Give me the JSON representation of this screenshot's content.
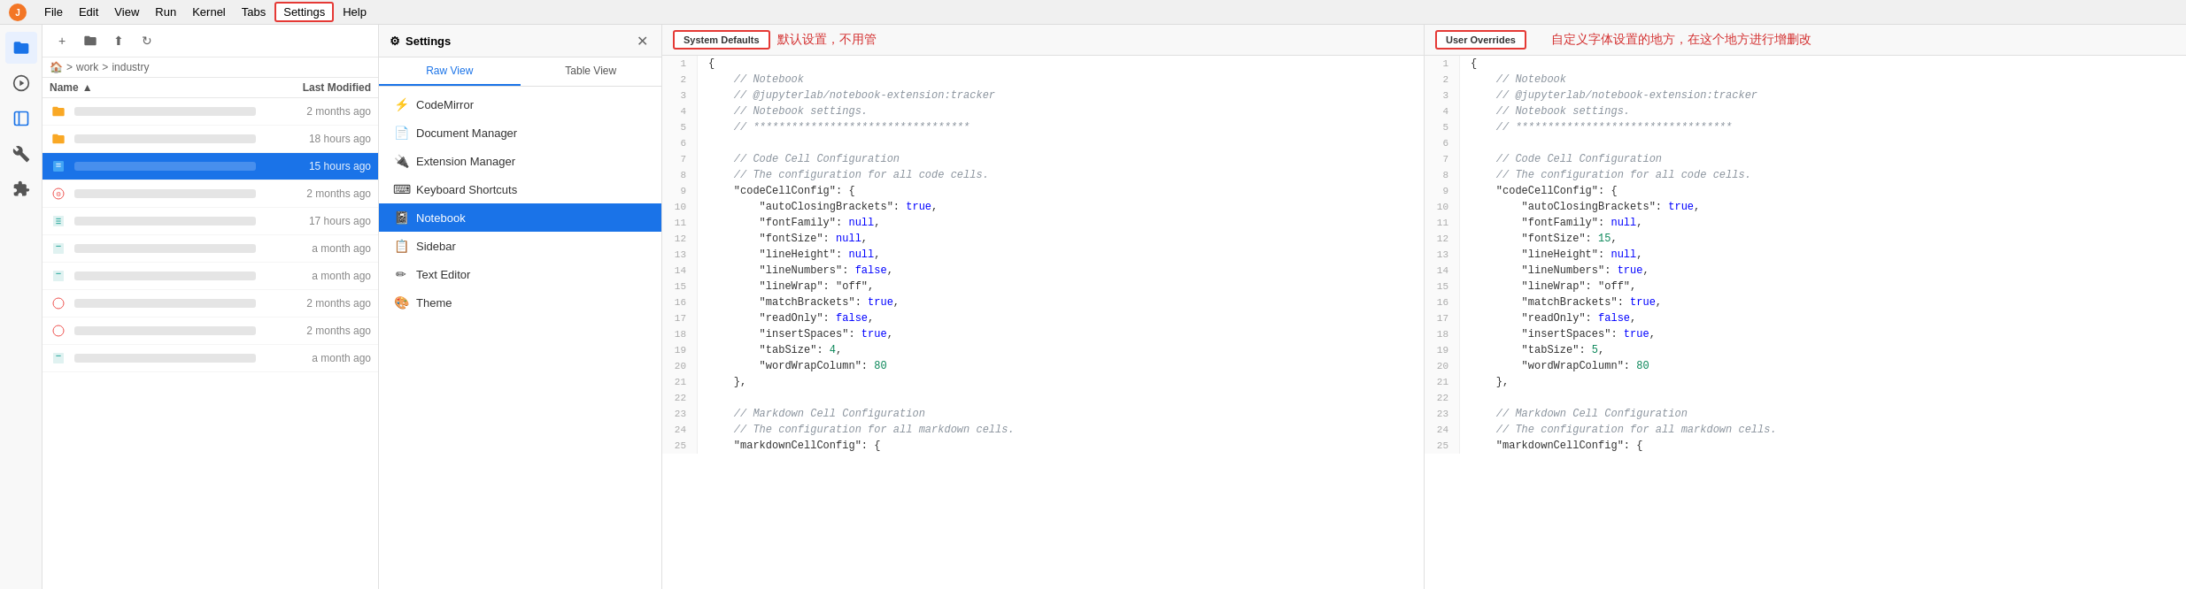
{
  "app": {
    "title": "JupyterLab"
  },
  "menubar": {
    "items": [
      "File",
      "Edit",
      "View",
      "Run",
      "Kernel",
      "Tabs",
      "Settings",
      "Help"
    ],
    "active": "Settings"
  },
  "toolbar": {
    "buttons": [
      "+",
      "📁",
      "⬆",
      "🔄"
    ]
  },
  "breadcrumb": {
    "items": [
      "🏠",
      "work",
      "industry"
    ],
    "separators": [
      ">",
      ">"
    ]
  },
  "filelist": {
    "header": {
      "name": "Name",
      "modified": "Last Modified"
    },
    "items": [
      {
        "icon": "📁",
        "name_blur": true,
        "modified": "2 months ago",
        "selected": false,
        "type": "folder"
      },
      {
        "icon": "📁",
        "name_blur": true,
        "modified": "18 hours ago",
        "selected": false,
        "type": "folder"
      },
      {
        "icon": "📄",
        "name_blur": true,
        "modified": "15 hours ago",
        "selected": true,
        "type": "notebook"
      },
      {
        "icon": "🔧",
        "name_blur": true,
        "modified": "2 months ago",
        "selected": false,
        "type": "tool"
      },
      {
        "icon": "📊",
        "name_blur": true,
        "modified": "17 hours ago",
        "selected": false,
        "type": "data"
      },
      {
        "icon": "📊",
        "name_blur": true,
        "modified": "a month ago",
        "selected": false,
        "type": "data"
      },
      {
        "icon": "📊",
        "name_blur": true,
        "modified": "a month ago",
        "selected": false,
        "type": "data"
      },
      {
        "icon": "🔧",
        "name_blur": true,
        "modified": "2 months ago",
        "selected": false,
        "type": "tool"
      },
      {
        "icon": "🔧",
        "name_blur": true,
        "modified": "2 months ago",
        "selected": false,
        "type": "tool"
      },
      {
        "icon": "📊",
        "name_blur": true,
        "modified": "a month ago",
        "selected": false,
        "type": "data"
      }
    ]
  },
  "settings": {
    "title": "Settings",
    "tabs": [
      "Raw View",
      "Table View"
    ],
    "active_tab": "Raw View",
    "menu_items": [
      {
        "icon": "⚡",
        "label": "CodeMirror"
      },
      {
        "icon": "📄",
        "label": "Document Manager"
      },
      {
        "icon": "🔌",
        "label": "Extension Manager"
      },
      {
        "icon": "⌨",
        "label": "Keyboard Shortcuts"
      },
      {
        "icon": "📓",
        "label": "Notebook",
        "active": true
      },
      {
        "icon": "📋",
        "label": "Sidebar"
      },
      {
        "icon": "✏",
        "label": "Text Editor"
      },
      {
        "icon": "🎨",
        "label": "Theme"
      }
    ]
  },
  "editor": {
    "panes": [
      {
        "label": "System Defaults",
        "label_note": "默认设置，不用管"
      },
      {
        "label": "User Overrides",
        "label_note": "自定义字体设置的地方，在这个地方进行增删改"
      }
    ],
    "code_lines": [
      "{",
      "    // Notebook",
      "    // @jupyterlab/notebook-extension:tracker",
      "    // Notebook settings.",
      "    // **********************************",
      "",
      "    // Code Cell Configuration",
      "    // The configuration for all code cells.",
      "    \"codeCellConfig\": {",
      "        \"autoClosingBrackets\": true,",
      "        \"fontFamily\": null,",
      "        \"fontSize\": null,",
      "        \"lineHeight\": null,",
      "        \"lineNumbers\": false,",
      "        \"lineWrap\": \"off\",",
      "        \"matchBrackets\": true,",
      "        \"readOnly\": false,",
      "        \"insertSpaces\": true,",
      "        \"tabSize\": 4,",
      "        \"wordWrapColumn\": 80",
      "    },",
      "",
      "    // Markdown Cell Configuration",
      "    // The configuration for all markdown cells.",
      "    \"markdownCellConfig\": {"
    ],
    "user_code_lines": [
      "{",
      "    // Notebook",
      "    // @jupyterlab/notebook-extension:tracker",
      "    // Notebook settings.",
      "    // **********************************",
      "",
      "    // Code Cell Configuration",
      "    // The configuration for all code cells.",
      "    \"codeCellConfig\": {",
      "        \"autoClosingBrackets\": true,",
      "        \"fontFamily\": null,",
      "        \"fontSize\": 15,",
      "        \"lineHeight\": null,",
      "        \"lineNumbers\": true,",
      "        \"lineWrap\": \"off\",",
      "        \"matchBrackets\": true,",
      "        \"readOnly\": false,",
      "        \"insertSpaces\": true,",
      "        \"tabSize\": 5,",
      "        \"wordWrapColumn\": 80",
      "    },",
      "",
      "    // Markdown Cell Configuration",
      "    // The configuration for all markdown cells.",
      "    \"markdownCellConfig\": {"
    ]
  },
  "annotations": {
    "zh_right_top": "自定义字体设置的地方，\n在这个地方进行增删改",
    "zh_center": "默认设置，不用管"
  }
}
